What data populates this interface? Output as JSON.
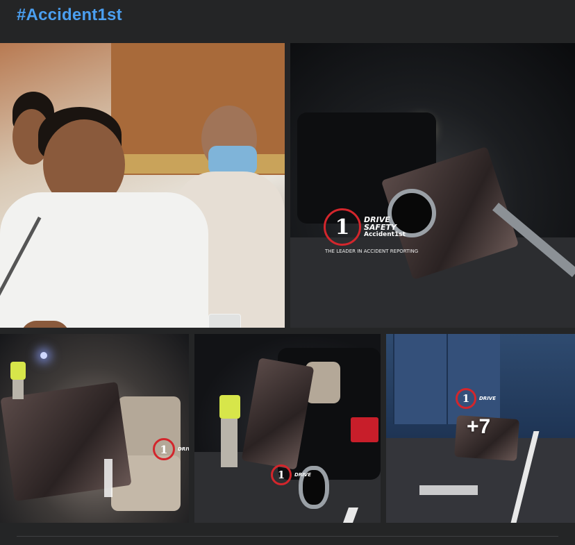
{
  "post": {
    "hashtag": "#Accident1st",
    "more_photos_label": "+7"
  },
  "watermarks": {
    "brand_line1": "DRIVE",
    "brand_line2": "SAFETY",
    "brand_tagline": "Accident1st",
    "brand_slogan": "THE LEADER IN ACCIDENT REPORTING",
    "logo_numeral": "1"
  },
  "photos": [
    {
      "name": "photo-speaker",
      "icon": "portrait-photo"
    },
    {
      "name": "photo-night-crash-suv",
      "icon": "crash-photo"
    },
    {
      "name": "photo-wrecked-interior",
      "icon": "crash-photo"
    },
    {
      "name": "photo-black-suv-worker",
      "icon": "crash-photo"
    },
    {
      "name": "photo-container-truck",
      "icon": "crash-photo"
    }
  ],
  "colors": {
    "background": "#242526",
    "hashtag": "#4b9ff0",
    "watermark_ring": "#d3262c"
  }
}
